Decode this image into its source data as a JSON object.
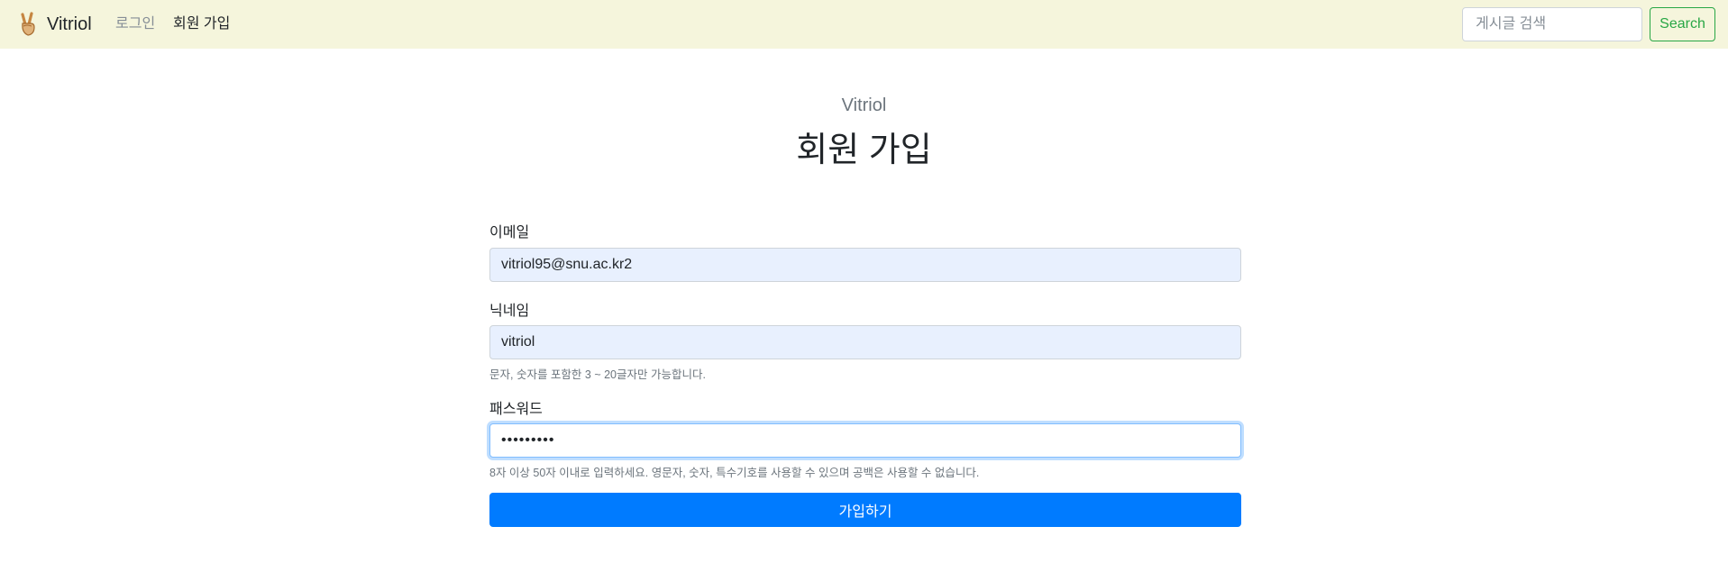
{
  "navbar": {
    "brand_name": "Vitriol",
    "brand_icon": "peace-hand-icon",
    "links": [
      {
        "label": "로그인"
      },
      {
        "label": "회원 가입"
      }
    ],
    "search": {
      "placeholder": "게시글 검색",
      "button_label": "Search"
    },
    "colors": {
      "background": "#f5f5dc",
      "search_button": "#28a745"
    }
  },
  "header": {
    "site_name": "Vitriol",
    "title": "회원 가입"
  },
  "form": {
    "email": {
      "label": "이메일",
      "value": "vitriol95@snu.ac.kr2"
    },
    "nickname": {
      "label": "닉네임",
      "value": "vitriol",
      "help": "문자, 숫자를 포함한 3 ~ 20글자만 가능합니다."
    },
    "password": {
      "label": "패스워드",
      "value": "•••••••••",
      "help": "8자 이상 50자 이내로 입력하세요. 영문자, 숫자, 특수기호를 사용할 수 있으며 공백은 사용할 수 없습니다."
    },
    "submit_label": "가입하기",
    "colors": {
      "submit": "#007bff",
      "autofill": "#e8f0fe",
      "focus": "#80bdff"
    }
  }
}
